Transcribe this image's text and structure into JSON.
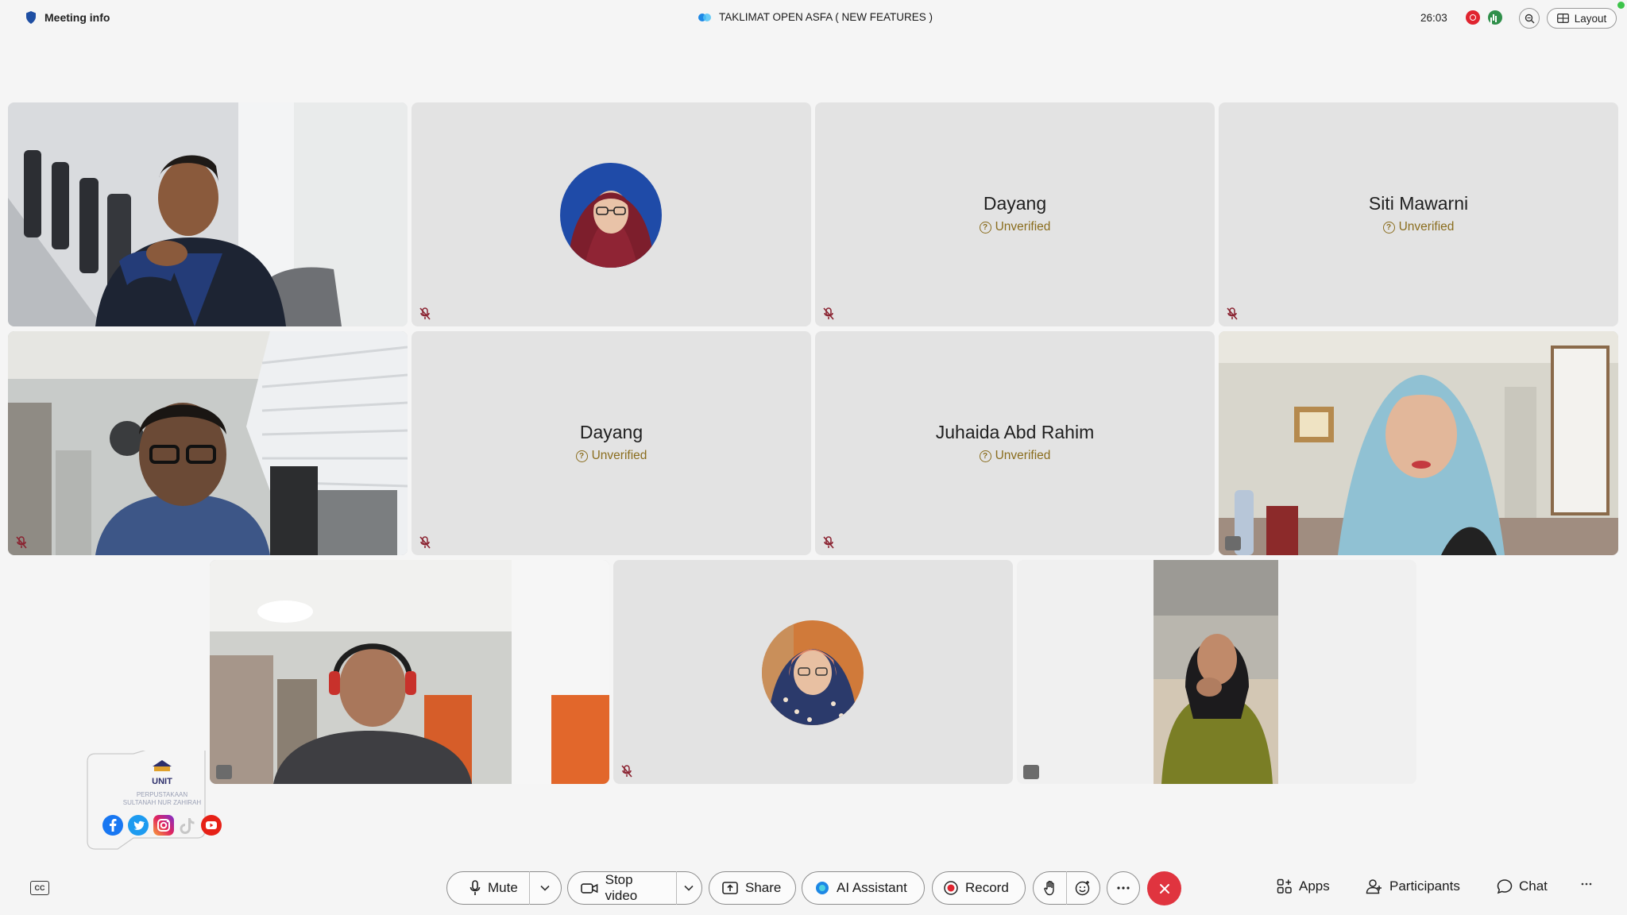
{
  "topbar": {
    "meeting_info_label": "Meeting info",
    "title": "TAKLIMAT OPEN ASFA ( NEW FEATURES )",
    "timer": "26:03",
    "layout_label": "Layout"
  },
  "participants": [
    {
      "name": "",
      "type": "video"
    },
    {
      "name": "",
      "type": "avatar"
    },
    {
      "name": "Dayang",
      "type": "name",
      "status": "Unverified"
    },
    {
      "name": "Siti Mawarni",
      "type": "name",
      "status": "Unverified"
    },
    {
      "name": "",
      "type": "video"
    },
    {
      "name": "Dayang",
      "type": "name",
      "status": "Unverified"
    },
    {
      "name": "Juhaida Abd Rahim",
      "type": "name",
      "status": "Unverified"
    },
    {
      "name": "",
      "type": "video"
    },
    {
      "name": "",
      "type": "video"
    },
    {
      "name": "",
      "type": "avatar"
    },
    {
      "name": "",
      "type": "video"
    }
  ],
  "logo": {
    "unit": "UNIT",
    "line1": "PERPUSTAKAAN",
    "line2": "SULTANAH NUR ZAHIRAH"
  },
  "toolbar": {
    "mute_label": "Mute",
    "stop_video_label": "Stop video",
    "share_label": "Share",
    "ai_assistant_label": "AI Assistant",
    "record_label": "Record",
    "apps_label": "Apps",
    "participants_label": "Participants",
    "chat_label": "Chat"
  },
  "colors": {
    "end_call": "#e0343f",
    "record_dot": "#e0242f",
    "unverified": "#8a6d1e"
  }
}
